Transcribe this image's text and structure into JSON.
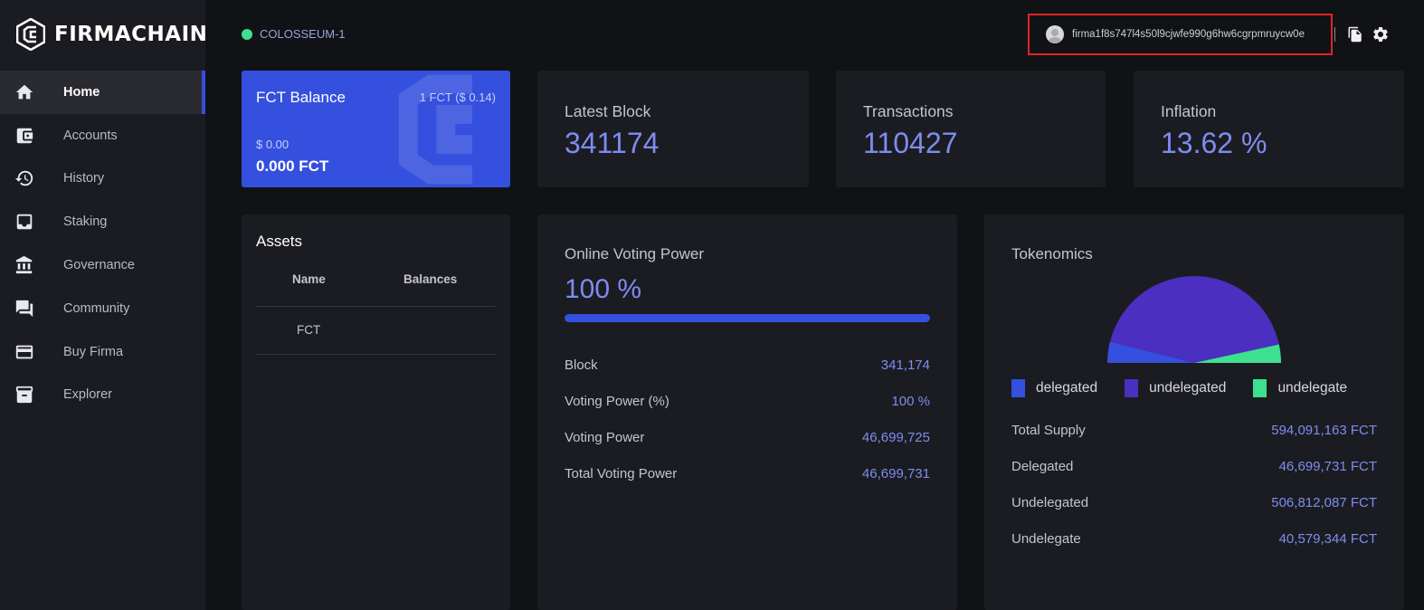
{
  "brand": {
    "name": "FIRMACHAIN"
  },
  "sidebar": {
    "items": [
      {
        "label": "Home",
        "icon": "home-icon"
      },
      {
        "label": "Accounts",
        "icon": "wallet-icon"
      },
      {
        "label": "History",
        "icon": "history-icon"
      },
      {
        "label": "Staking",
        "icon": "inbox-icon"
      },
      {
        "label": "Governance",
        "icon": "bank-icon"
      },
      {
        "label": "Community",
        "icon": "chat-icon"
      },
      {
        "label": "Buy Firma",
        "icon": "credit-card-icon"
      },
      {
        "label": "Explorer",
        "icon": "archive-icon"
      }
    ],
    "active_index": 0
  },
  "header": {
    "network": "COLOSSEUM-1",
    "network_color": "#3ee08f",
    "address": "firma1f8s747l4s50l9cjwfe990g6hw6cgrpmruycw0e"
  },
  "balance": {
    "title": "FCT Balance",
    "rate": "1 FCT ($ 0.14)",
    "usd": "$ 0.00",
    "amount": "0.000 FCT"
  },
  "stats": [
    {
      "label": "Latest Block",
      "value": "341174"
    },
    {
      "label": "Transactions",
      "value": "110427"
    },
    {
      "label": "Inflation",
      "value": "13.62 %"
    }
  ],
  "assets": {
    "title": "Assets",
    "columns": [
      "Name",
      "Balances"
    ],
    "rows": [
      {
        "name": "FCT",
        "balance": ""
      }
    ]
  },
  "voting": {
    "title": "Online Voting Power",
    "percent": "100 %",
    "progress": 1.0,
    "rows": [
      {
        "label": "Block",
        "value": "341,174"
      },
      {
        "label": "Voting Power (%)",
        "value": "100 %"
      },
      {
        "label": "Voting Power",
        "value": "46,699,725"
      },
      {
        "label": "Total Voting Power",
        "value": "46,699,731"
      }
    ]
  },
  "tokenomics": {
    "title": "Tokenomics",
    "legend": [
      {
        "label": "delegated",
        "color": "#3550de"
      },
      {
        "label": "undelegated",
        "color": "#4b2fc0"
      },
      {
        "label": "undelegate",
        "color": "#3ee08f"
      }
    ],
    "rows": [
      {
        "label": "Total Supply",
        "value": "594,091,163 FCT"
      },
      {
        "label": "Delegated",
        "value": "46,699,731 FCT"
      },
      {
        "label": "Undelegated",
        "value": "506,812,087 FCT"
      },
      {
        "label": "Undelegate",
        "value": "40,579,344 FCT"
      }
    ]
  },
  "chart_data": {
    "type": "pie",
    "title": "",
    "categories": [
      "delegated",
      "undelegated",
      "undelegate"
    ],
    "values": [
      46699731,
      506812087,
      40579344
    ],
    "colors": [
      "#3550de",
      "#4b2fc0",
      "#3ee08f"
    ],
    "shape": "half"
  },
  "colors": {
    "accent": "#3550de",
    "value_text": "#7e8cf0",
    "background": "#111216",
    "panel": "#1b1c21"
  }
}
